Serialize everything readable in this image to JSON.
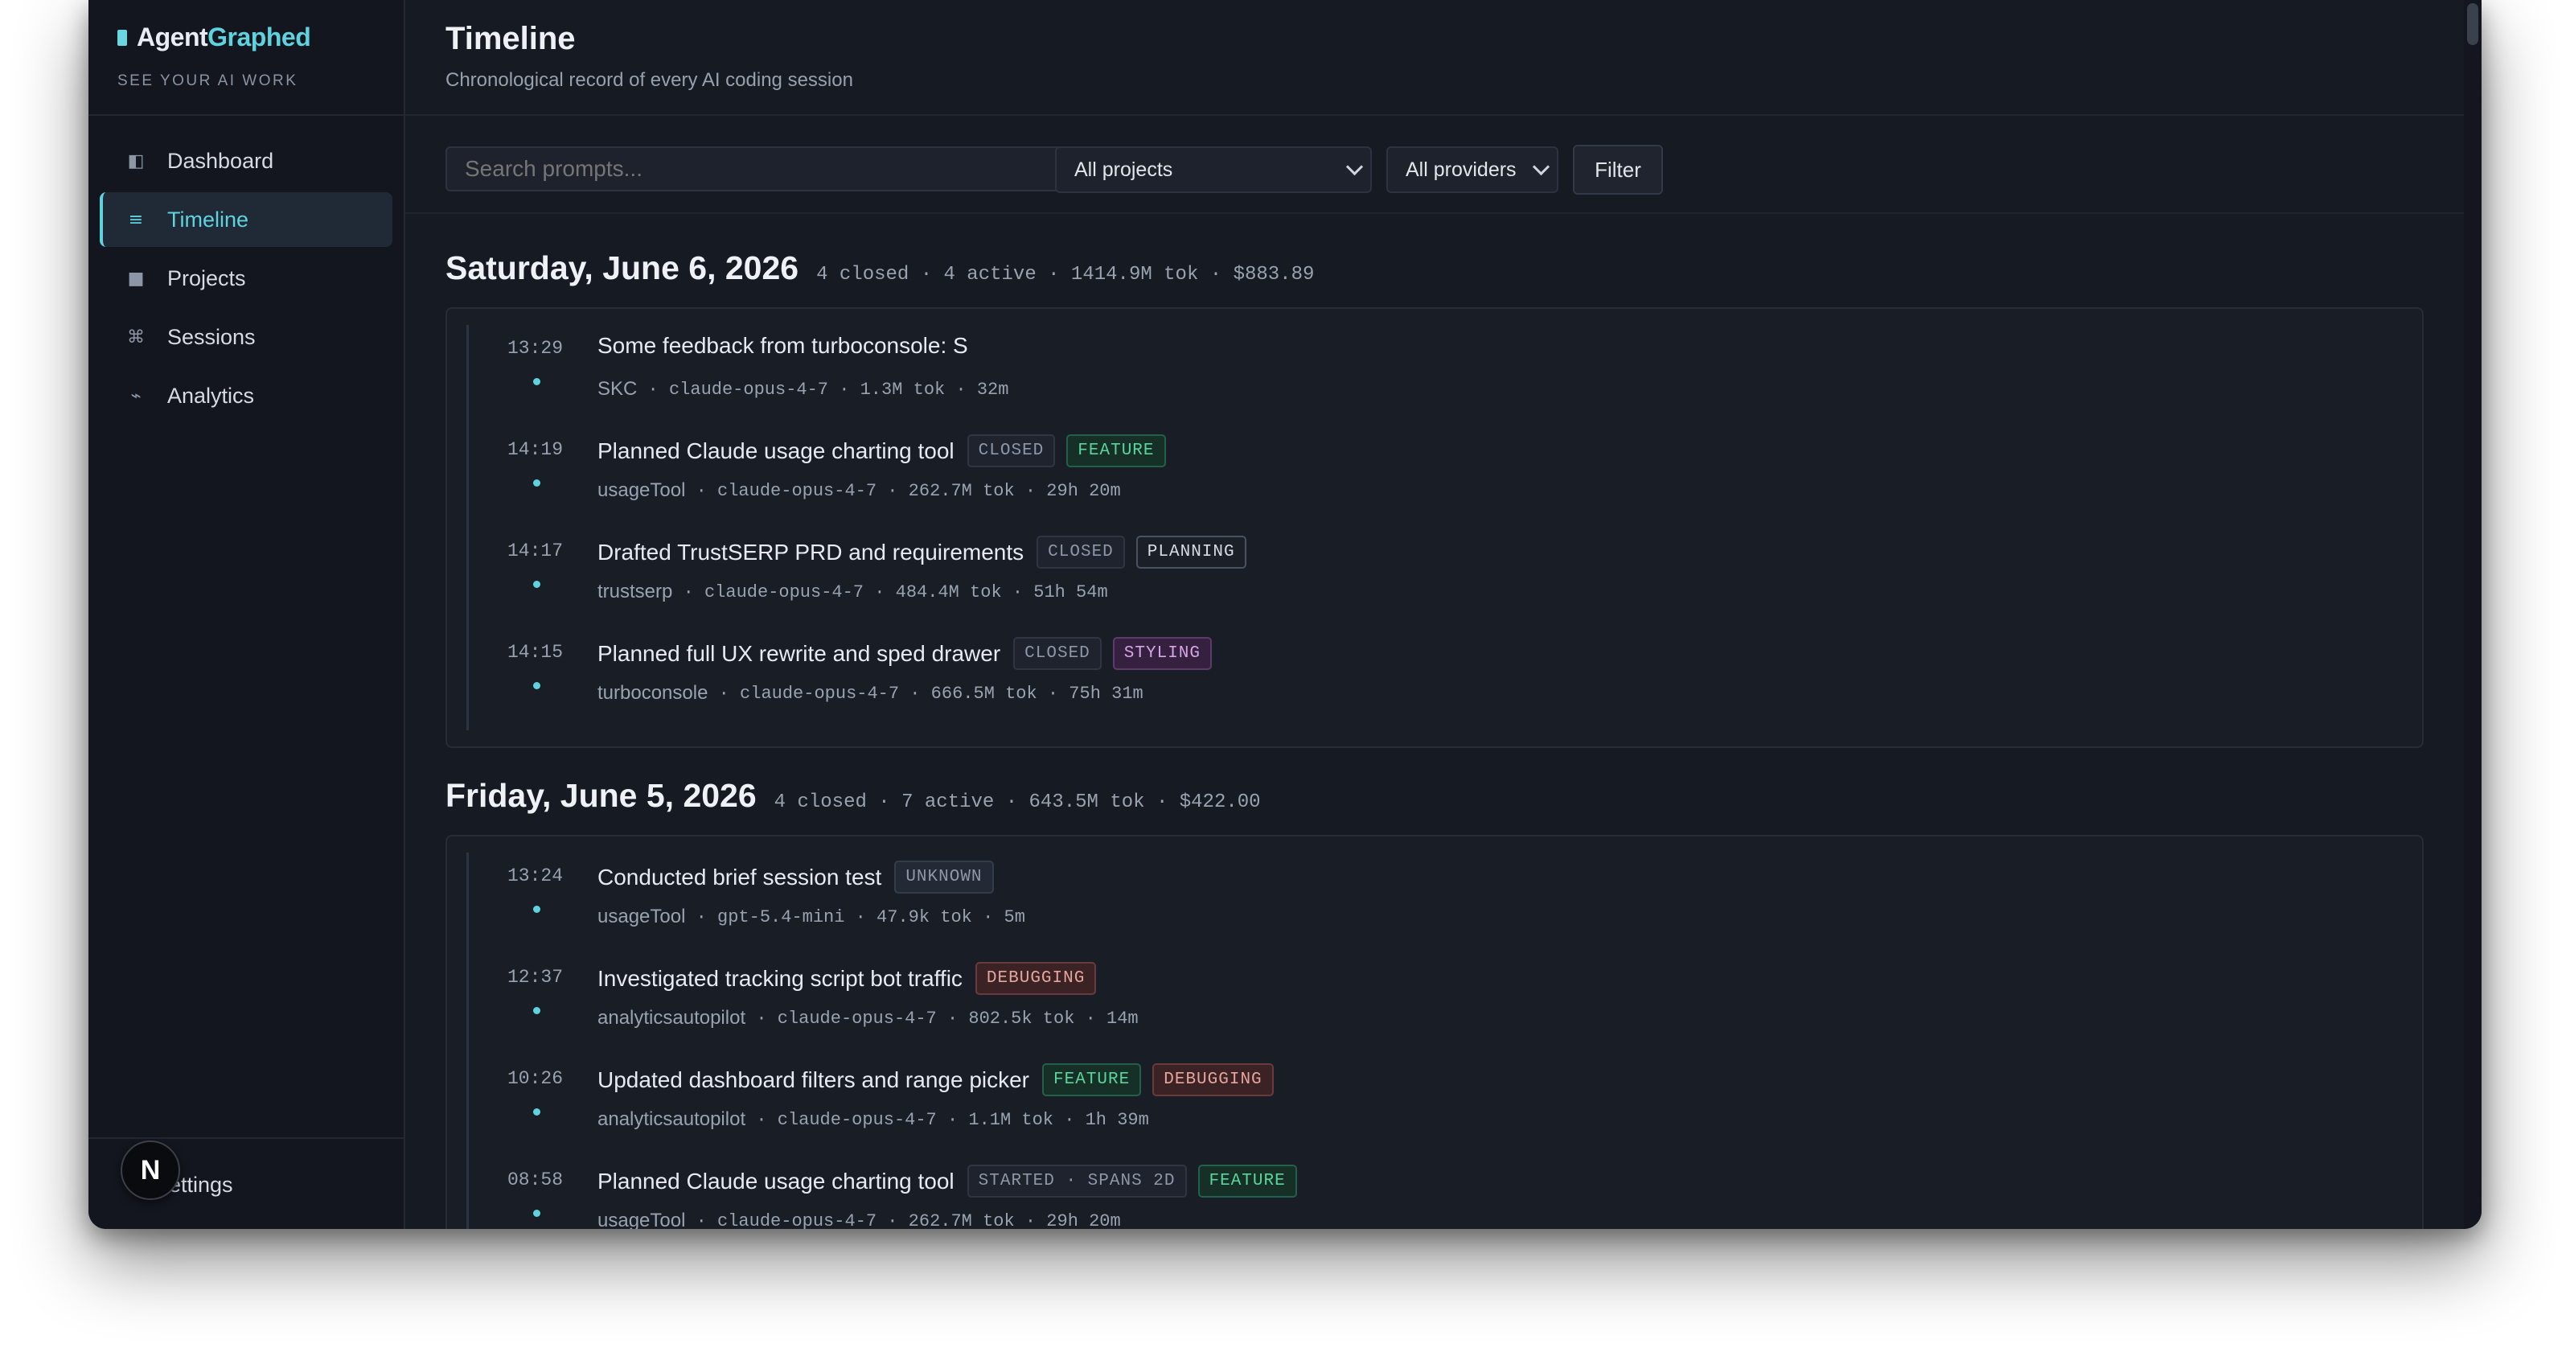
{
  "brand": {
    "prefix": "Agent",
    "accent": "Graphed",
    "tagline": "SEE YOUR AI WORK"
  },
  "sidebar": {
    "items": [
      {
        "label": "Dashboard",
        "icon": "dashboard-icon",
        "active": false
      },
      {
        "label": "Timeline",
        "icon": "timeline-icon",
        "active": true
      },
      {
        "label": "Projects",
        "icon": "projects-icon",
        "active": false
      },
      {
        "label": "Sessions",
        "icon": "sessions-icon",
        "active": false
      },
      {
        "label": "Analytics",
        "icon": "analytics-icon",
        "active": false
      }
    ],
    "settings_label": "Settings",
    "badge": "N"
  },
  "header": {
    "title": "Timeline",
    "subtitle": "Chronological record of every AI coding session"
  },
  "filters": {
    "search_placeholder": "Search prompts...",
    "project_select": "All projects",
    "provider_select": "All providers",
    "filter_button": "Filter"
  },
  "days": [
    {
      "title": "Saturday, June 6, 2026",
      "meta": "4 closed · 4 active · 1414.9M tok · $883.89",
      "sessions": [
        {
          "time": "13:29",
          "title": "Some feedback from turboconsole: S",
          "tags": [],
          "project": "SKC",
          "meta": " · claude-opus-4-7 · 1.3M tok · 32m"
        },
        {
          "time": "14:19",
          "title": "Planned Claude usage charting tool",
          "tags": [
            {
              "label": "CLOSED",
              "kind": "closed"
            },
            {
              "label": "FEATURE",
              "kind": "feature"
            }
          ],
          "project": "usageTool",
          "meta": " · claude-opus-4-7 · 262.7M tok · 29h 20m"
        },
        {
          "time": "14:17",
          "title": "Drafted TrustSERP PRD and requirements",
          "tags": [
            {
              "label": "CLOSED",
              "kind": "closed"
            },
            {
              "label": "PLANNING",
              "kind": "planning"
            }
          ],
          "project": "trustserp",
          "meta": " · claude-opus-4-7 · 484.4M tok · 51h 54m"
        },
        {
          "time": "14:15",
          "title": "Planned full UX rewrite and sped drawer",
          "tags": [
            {
              "label": "CLOSED",
              "kind": "closed"
            },
            {
              "label": "STYLING",
              "kind": "styling"
            }
          ],
          "project": "turboconsole",
          "meta": " · claude-opus-4-7 · 666.5M tok · 75h 31m"
        }
      ]
    },
    {
      "title": "Friday, June 5, 2026",
      "meta": "4 closed · 7 active · 643.5M tok · $422.00",
      "sessions": [
        {
          "time": "13:24",
          "title": "Conducted brief session test",
          "tags": [
            {
              "label": "UNKNOWN",
              "kind": "unknown"
            }
          ],
          "project": "usageTool",
          "meta": " · gpt-5.4-mini · 47.9k tok · 5m"
        },
        {
          "time": "12:37",
          "title": "Investigated tracking script bot traffic",
          "tags": [
            {
              "label": "DEBUGGING",
              "kind": "debugging"
            }
          ],
          "project": "analyticsautopilot",
          "meta": " · claude-opus-4-7 · 802.5k tok · 14m"
        },
        {
          "time": "10:26",
          "title": "Updated dashboard filters and range picker",
          "tags": [
            {
              "label": "FEATURE",
              "kind": "feature"
            },
            {
              "label": "DEBUGGING",
              "kind": "debugging"
            }
          ],
          "project": "analyticsautopilot",
          "meta": " · claude-opus-4-7 · 1.1M tok · 1h 39m"
        },
        {
          "time": "08:58",
          "title": "Planned Claude usage charting tool",
          "tags": [
            {
              "label": "STARTED · SPANS 2D",
              "kind": "started"
            },
            {
              "label": "FEATURE",
              "kind": "feature"
            }
          ],
          "project": "usageTool",
          "meta": " · claude-opus-4-7 · 262.7M tok · 29h 20m"
        }
      ]
    }
  ],
  "colors": {
    "accent": "#5ed3df",
    "background": "#161a23",
    "sidebar": "#13161e",
    "feature": "#59d49b",
    "debugging": "#e6a59c",
    "styling": "#d7a5e6"
  }
}
